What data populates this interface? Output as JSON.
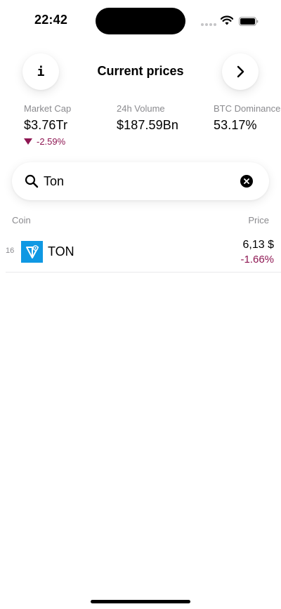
{
  "status_bar": {
    "time": "22:42"
  },
  "header": {
    "title": "Current prices",
    "info_glyph": "i"
  },
  "stats": {
    "market_cap": {
      "label": "Market Cap",
      "value": "$3.76Tr",
      "change": "-2.59%"
    },
    "volume_24h": {
      "label": "24h Volume",
      "value": "$187.59Bn"
    },
    "btc_dominance": {
      "label": "BTC Dominance",
      "value": "53.17%"
    }
  },
  "search": {
    "value": "Ton"
  },
  "table": {
    "col_coin": "Coin",
    "col_price": "Price",
    "rows": [
      {
        "rank": "16",
        "name": "TON",
        "price": "6,13 $",
        "change": "-1.66%"
      }
    ]
  },
  "colors": {
    "negative": "#8e1652",
    "ton_brand": "#0f98e3",
    "muted": "#8a8a8e"
  },
  "icons": [
    "info-icon",
    "chevron-right-icon",
    "search-icon",
    "clear-icon",
    "wifi-icon",
    "battery-icon",
    "ton-logo-icon"
  ]
}
